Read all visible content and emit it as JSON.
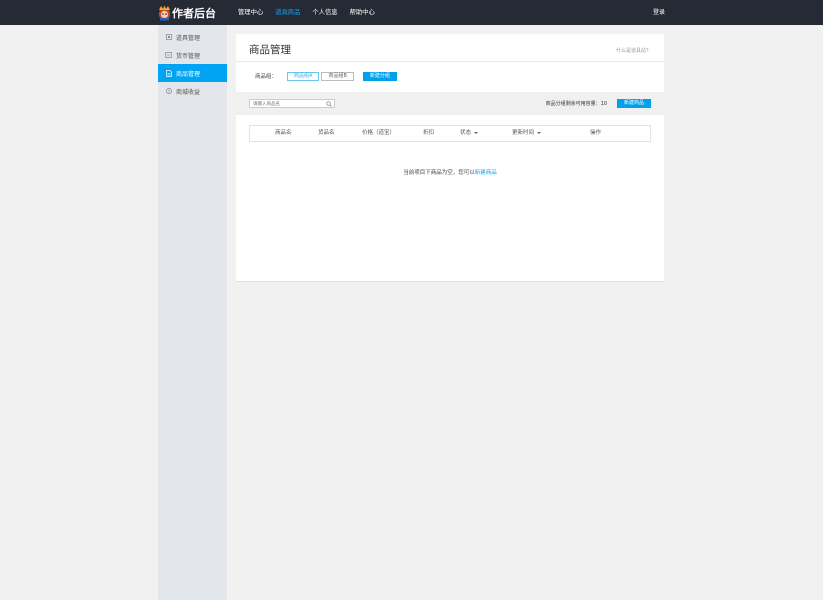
{
  "header": {
    "logo_text": "作者后台",
    "nav": [
      {
        "label": "管理中心",
        "active": false
      },
      {
        "label": "道具商品",
        "active": true
      },
      {
        "label": "个人信息",
        "active": false
      },
      {
        "label": "帮助中心",
        "active": false
      }
    ],
    "login_label": "登录"
  },
  "sidebar": {
    "items": [
      {
        "label": "道具管理",
        "icon": "box-icon",
        "active": false
      },
      {
        "label": "货币管理",
        "icon": "currency-card-icon",
        "active": false
      },
      {
        "label": "商品管理",
        "icon": "document-icon",
        "active": true
      },
      {
        "label": "商城收益",
        "icon": "coin-icon",
        "active": false
      }
    ]
  },
  "main": {
    "title": "商品管理",
    "help_link": "什么是道具站？",
    "group_label": "商品组：",
    "groups": [
      {
        "label": "商品组A",
        "selected": true
      },
      {
        "label": "商品组B",
        "selected": false
      }
    ],
    "new_group_label": "新建分组",
    "search": {
      "placeholder": "请输入商品名",
      "value": ""
    },
    "quota_text": "商品分组剩余可用容量：10",
    "new_item_label": "新建商品",
    "table": {
      "columns": [
        "商品名",
        "货品名",
        "价格（道宝）",
        "折扣",
        "状态",
        "更新时间",
        "操作"
      ]
    },
    "empty": {
      "message": "当前项目下商品为空，您可以",
      "link": "新建商品"
    }
  },
  "colors": {
    "topbar_bg": "#262a35",
    "accent": "#00a4f3",
    "sidebar_bg": "#e3e6ea",
    "page_bg": "#f1f1f1"
  }
}
